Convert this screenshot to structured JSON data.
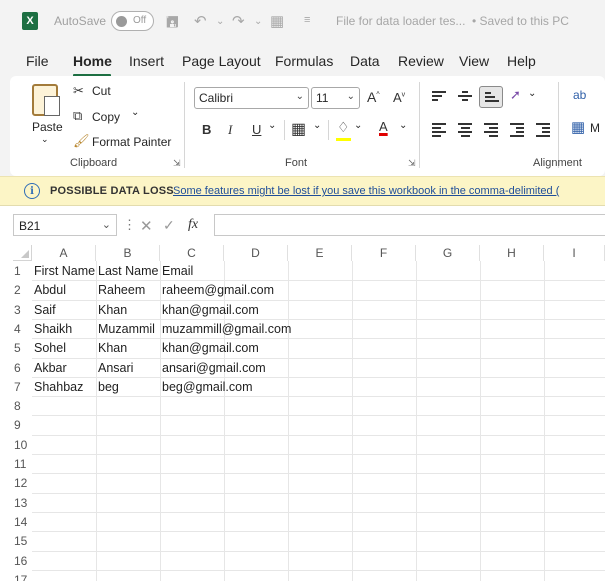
{
  "titlebar": {
    "app_icon": "X",
    "autosave_label": "AutoSave",
    "autosave_state": "Off",
    "document_title": "File for data loader tes...",
    "save_status": "• Saved to this PC",
    "save_status_chevron": "⌄"
  },
  "menu": {
    "tabs": [
      "File",
      "Home",
      "Insert",
      "Page Layout",
      "Formulas",
      "Data",
      "Review",
      "View",
      "Help"
    ],
    "active_tab": "Home"
  },
  "ribbon": {
    "clipboard": {
      "paste_label": "Paste",
      "cut_label": "Cut",
      "copy_label": "Copy",
      "format_painter_label": "Format Painter",
      "group_label": "Clipboard"
    },
    "font": {
      "font_name": "Calibri",
      "font_size": "11",
      "bold": "B",
      "italic": "I",
      "underline": "U",
      "group_label": "Font",
      "increase_font": "A",
      "decrease_font": "A",
      "font_color_letter": "A"
    },
    "alignment": {
      "group_label": "Alignment"
    },
    "wrap_label": "ab"
  },
  "infobar": {
    "title": "POSSIBLE DATA LOSS",
    "message": "Some features might be lost if you save this workbook in the comma-delimited ("
  },
  "formula_bar": {
    "name_box": "B21",
    "fx": "fx",
    "value": ""
  },
  "sheet": {
    "columns": [
      "A",
      "B",
      "C",
      "D",
      "E",
      "F",
      "G",
      "H",
      "I"
    ],
    "row_numbers": [
      "1",
      "2",
      "3",
      "4",
      "5",
      "6",
      "7",
      "8",
      "9",
      "10",
      "11",
      "12",
      "13",
      "14",
      "15",
      "16",
      "17"
    ],
    "rows": [
      [
        "First Name",
        "Last Name",
        "Email"
      ],
      [
        "Abdul",
        "Raheem",
        "raheem@gmail.com"
      ],
      [
        "Saif",
        "Khan",
        "khan@gmail.com"
      ],
      [
        "Shaikh",
        "Muzammil",
        "muzammill@gmail.com"
      ],
      [
        "Sohel",
        "Khan",
        "khan@gmail.com"
      ],
      [
        "Akbar",
        "Ansari",
        "ansari@gmail.com"
      ],
      [
        "Shahbaz",
        "beg",
        "beg@gmail.com"
      ]
    ]
  },
  "colors": {
    "excel_green": "#1d6f42",
    "infobar_bg": "#fcf5c6",
    "link_blue": "#1f4e99"
  }
}
